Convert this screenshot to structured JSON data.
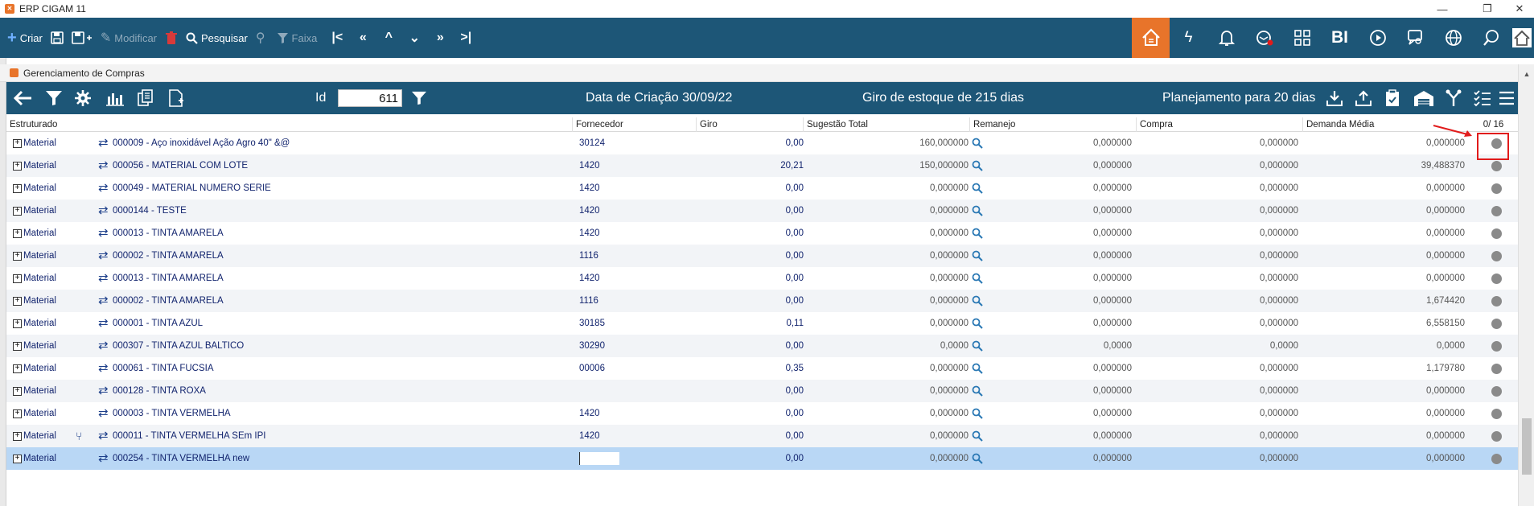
{
  "window": {
    "title": "ERP CIGAM 11"
  },
  "toolbar": {
    "criar": "Criar",
    "modificar": "Modificar",
    "pesquisar": "Pesquisar",
    "faixa": "Faixa",
    "bi": "BI"
  },
  "inner": {
    "title": "Gerenciamento de Compras"
  },
  "subbar": {
    "id_label": "Id",
    "id_value": "611",
    "data_criacao": "Data de Criação 30/09/22",
    "giro_estoque": "Giro de estoque de  215 dias",
    "planejamento": "Planejamento para 20 dias"
  },
  "columns": {
    "estruturado": "Estruturado",
    "fornecedor": "Fornecedor",
    "giro": "Giro",
    "sugestao": "Sugestão Total",
    "remanejo": "Remanejo",
    "compra": "Compra",
    "demanda": "Demanda Média",
    "count": "0/ 16"
  },
  "rows": [
    {
      "tipo": "Material",
      "descricao": "000009 - Aço inoxidável Ação Agro 40\" &@",
      "fornecedor": "30124",
      "giro": "0,00",
      "sugestao": "160,000000",
      "remanejo": "0,000000",
      "compra": "0,000000",
      "demanda": "0,000000"
    },
    {
      "tipo": "Material",
      "descricao": "000056 - MATERIAL  COM LOTE",
      "fornecedor": "1420",
      "giro": "20,21",
      "sugestao": "150,000000",
      "remanejo": "0,000000",
      "compra": "0,000000",
      "demanda": "39,488370"
    },
    {
      "tipo": "Material",
      "descricao": "000049 - MATERIAL NUMERO SERIE",
      "fornecedor": "1420",
      "giro": "0,00",
      "sugestao": "0,000000",
      "remanejo": "0,000000",
      "compra": "0,000000",
      "demanda": "0,000000"
    },
    {
      "tipo": "Material",
      "descricao": "0000144 - TESTE",
      "fornecedor": "1420",
      "giro": "0,00",
      "sugestao": "0,000000",
      "remanejo": "0,000000",
      "compra": "0,000000",
      "demanda": "0,000000"
    },
    {
      "tipo": "Material",
      "descricao": "000013 - TINTA AMARELA",
      "fornecedor": "1420",
      "giro": "0,00",
      "sugestao": "0,000000",
      "remanejo": "0,000000",
      "compra": "0,000000",
      "demanda": "0,000000"
    },
    {
      "tipo": "Material",
      "descricao": "000002 - TINTA AMARELA",
      "fornecedor": "1116",
      "giro": "0,00",
      "sugestao": "0,000000",
      "remanejo": "0,000000",
      "compra": "0,000000",
      "demanda": "0,000000"
    },
    {
      "tipo": "Material",
      "descricao": "000013 - TINTA AMARELA",
      "fornecedor": "1420",
      "giro": "0,00",
      "sugestao": "0,000000",
      "remanejo": "0,000000",
      "compra": "0,000000",
      "demanda": "0,000000"
    },
    {
      "tipo": "Material",
      "descricao": "000002 - TINTA AMARELA",
      "fornecedor": "1116",
      "giro": "0,00",
      "sugestao": "0,000000",
      "remanejo": "0,000000",
      "compra": "0,000000",
      "demanda": "1,674420"
    },
    {
      "tipo": "Material",
      "descricao": "000001 - TINTA AZUL",
      "fornecedor": "30185",
      "giro": "0,11",
      "sugestao": "0,000000",
      "remanejo": "0,000000",
      "compra": "0,000000",
      "demanda": "6,558150"
    },
    {
      "tipo": "Material",
      "descricao": "000307 - TINTA AZUL BALTICO",
      "fornecedor": "30290",
      "giro": "0,00",
      "sugestao": "0,0000",
      "remanejo": "0,0000",
      "compra": "0,0000",
      "demanda": "0,0000"
    },
    {
      "tipo": "Material",
      "descricao": "000061 - TINTA FUCSIA",
      "fornecedor": "00006",
      "giro": "0,35",
      "sugestao": "0,000000",
      "remanejo": "0,000000",
      "compra": "0,000000",
      "demanda": "1,179780"
    },
    {
      "tipo": "Material",
      "descricao": "000128 - TINTA ROXA",
      "fornecedor": "",
      "giro": "0,00",
      "sugestao": "0,000000",
      "remanejo": "0,000000",
      "compra": "0,000000",
      "demanda": "0,000000"
    },
    {
      "tipo": "Material",
      "descricao": "000003 - TINTA VERMELHA",
      "fornecedor": "1420",
      "giro": "0,00",
      "sugestao": "0,000000",
      "remanejo": "0,000000",
      "compra": "0,000000",
      "demanda": "0,000000"
    },
    {
      "tipo": "Material",
      "descricao": "000011 - TINTA VERMELHA SEm IPI",
      "fornecedor": "1420",
      "giro": "0,00",
      "sugestao": "0,000000",
      "remanejo": "0,000000",
      "compra": "0,000000",
      "demanda": "0,000000",
      "fork": true
    },
    {
      "tipo": "Material",
      "descricao": "000254 - TINTA VERMELHA new",
      "fornecedor": "",
      "giro": "0,00",
      "sugestao": "0,000000",
      "remanejo": "0,000000",
      "compra": "0,000000",
      "demanda": "0,000000",
      "selected": true
    }
  ],
  "colors": {
    "toolbar": "#1d5677",
    "accent": "#e8742a",
    "selected_row": "#b9d7f5",
    "highlight": "#e11b1b"
  }
}
